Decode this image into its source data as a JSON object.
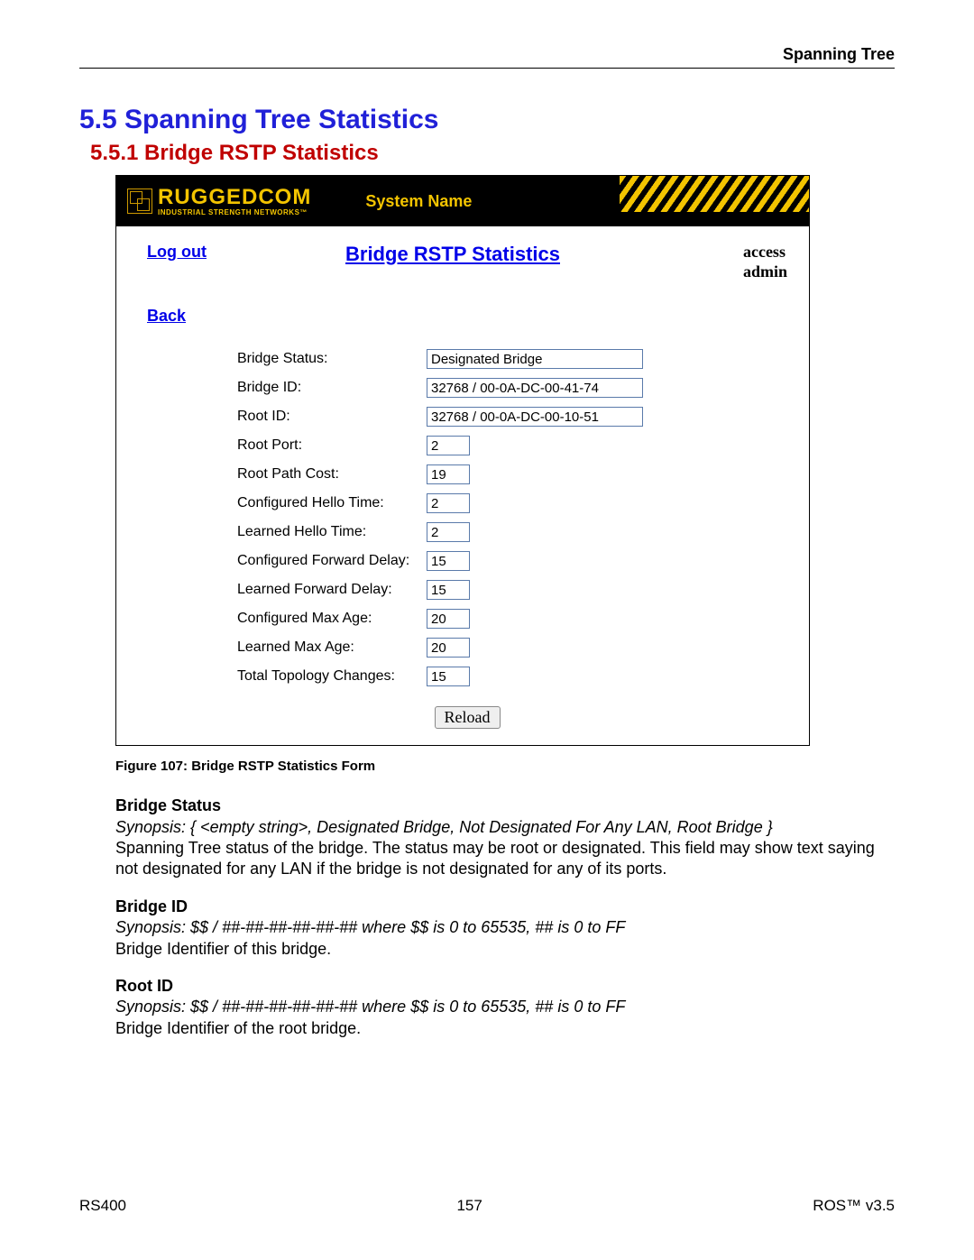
{
  "header": {
    "section": "Spanning Tree"
  },
  "headings": {
    "h55": "5.5  Spanning Tree Statistics",
    "h551": "5.5.1  Bridge RSTP Statistics"
  },
  "panel": {
    "logo_main": "RUGGEDCOM",
    "logo_sub": "INDUSTRIAL STRENGTH NETWORKS™",
    "system_name": "System Name",
    "logout": "Log out",
    "title": "Bridge RSTP Statistics",
    "access_line1": "access",
    "access_line2": "admin",
    "back": "Back",
    "reload": "Reload",
    "rows": [
      {
        "label": "Bridge Status:",
        "value": "Designated Bridge",
        "w": "wide"
      },
      {
        "label": "Bridge ID:",
        "value": "32768 / 00-0A-DC-00-41-74",
        "w": "wide"
      },
      {
        "label": "Root ID:",
        "value": "32768 / 00-0A-DC-00-10-51",
        "w": "wide"
      },
      {
        "label": "Root Port:",
        "value": "2",
        "w": "small"
      },
      {
        "label": "Root Path Cost:",
        "value": "19",
        "w": "small"
      },
      {
        "label": "Configured Hello Time:",
        "value": "2",
        "w": "small"
      },
      {
        "label": "Learned Hello Time:",
        "value": "2",
        "w": "small"
      },
      {
        "label": "Configured Forward Delay:",
        "value": "15",
        "w": "small"
      },
      {
        "label": "Learned Forward Delay:",
        "value": "15",
        "w": "small"
      },
      {
        "label": "Configured Max Age:",
        "value": "20",
        "w": "small"
      },
      {
        "label": "Learned Max Age:",
        "value": "20",
        "w": "small"
      },
      {
        "label": "Total Topology Changes:",
        "value": "15",
        "w": "small"
      }
    ]
  },
  "caption": "Figure 107: Bridge RSTP Statistics Form",
  "desc": {
    "bs_title": "Bridge Status",
    "bs_syn": "Synopsis: { <empty string>, Designated Bridge, Not Designated For Any LAN, Root Bridge }",
    "bs_body": "Spanning Tree status of the bridge. The status may be root or designated. This field may show text saying not designated for any LAN if the bridge is not designated for any of its ports.",
    "bid_title": "Bridge ID",
    "bid_syn": "Synopsis: $$ / ##-##-##-##-##-##  where $$ is 0 to 65535, ## is 0 to FF",
    "bid_body": "Bridge Identifier of this bridge.",
    "rid_title": "Root ID",
    "rid_syn": "Synopsis: $$ / ##-##-##-##-##-##  where $$ is 0 to 65535, ## is 0 to FF",
    "rid_body": "Bridge Identifier of the root bridge."
  },
  "footer": {
    "left": "RS400",
    "center": "157",
    "right": "ROS™   v3.5"
  }
}
